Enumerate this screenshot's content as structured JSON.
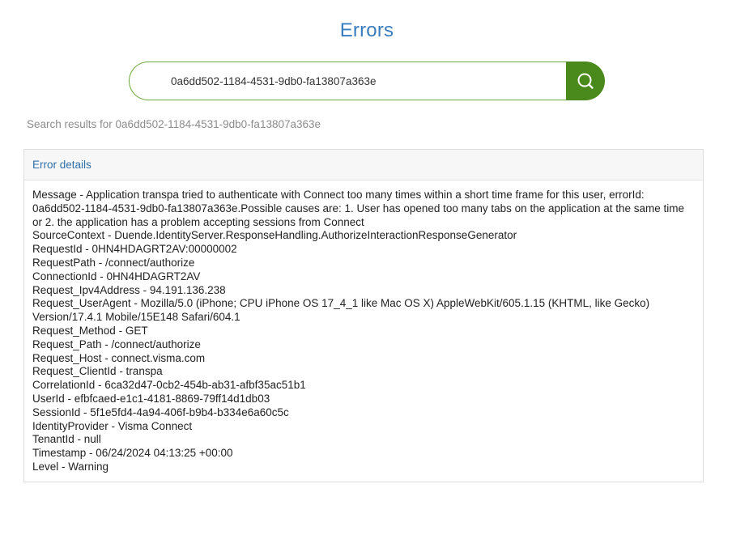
{
  "page": {
    "title": "Errors"
  },
  "search": {
    "value": "0a6dd502-1184-4531-9db0-fa13807a363e",
    "button_icon": "search-icon"
  },
  "results": {
    "summary": "Search results for 0a6dd502-1184-4531-9db0-fa13807a363e"
  },
  "colors": {
    "title": "#3a7dbf",
    "accent": "#4a8a1c",
    "input_border": "#6aa83a"
  },
  "error_details": {
    "header": "Error details",
    "lines": [
      "Message - Application transpa tried to authenticate with Connect too many times within a short time frame for this user, errorId: 0a6dd502-1184-4531-9db0-fa13807a363e.Possible causes are: 1. User has opened too many tabs on the application at the same time or 2. the application has a problem accepting sessions from Connect",
      "SourceContext - Duende.IdentityServer.ResponseHandling.AuthorizeInteractionResponseGenerator",
      "RequestId - 0HN4HDAGRT2AV:00000002",
      "RequestPath - /connect/authorize",
      "ConnectionId - 0HN4HDAGRT2AV",
      "Request_Ipv4Address - 94.191.136.238",
      "Request_UserAgent - Mozilla/5.0 (iPhone; CPU iPhone OS 17_4_1 like Mac OS X) AppleWebKit/605.1.15 (KHTML, like Gecko) Version/17.4.1 Mobile/15E148 Safari/604.1",
      "Request_Method - GET",
      "Request_Path - /connect/authorize",
      "Request_Host - connect.visma.com",
      "Request_ClientId - transpa",
      "CorrelationId - 6ca32d47-0cb2-454b-ab31-afbf35ac51b1",
      "UserId - efbfcaed-e1c1-4181-8869-79ff14d1db03",
      "SessionId - 5f1e5fd4-4a94-406f-b9b4-b334e6a60c5c",
      "IdentityProvider - Visma Connect",
      "TenantId - null",
      "Timestamp - 06/24/2024 04:13:25 +00:00",
      "Level - Warning"
    ]
  }
}
